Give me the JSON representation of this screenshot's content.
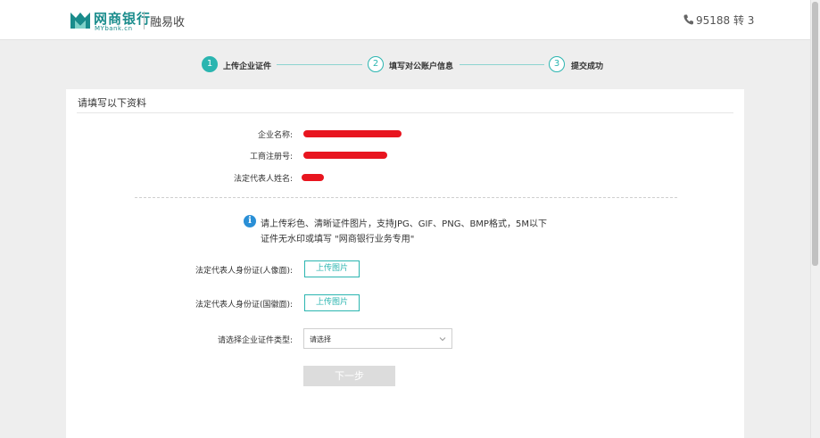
{
  "header": {
    "logo_cn": "网商银行",
    "logo_en": "MYbank.cn",
    "product": "融易收",
    "phone": "95188 转 3"
  },
  "steps": [
    {
      "number": "1",
      "label": "上传企业证件",
      "active": true
    },
    {
      "number": "2",
      "label": "填写对公账户信息",
      "active": false
    },
    {
      "number": "3",
      "label": "提交成功",
      "active": false
    }
  ],
  "form": {
    "title": "请填写以下资料",
    "info": [
      {
        "label": "企业名称:"
      },
      {
        "label": "工商注册号:"
      },
      {
        "label": "法定代表人姓名:"
      }
    ],
    "tip_line1": "请上传彩色、清晰证件图片，支持JPG、GIF、PNG、BMP格式，5M以下",
    "tip_line2": "证件无水印或填写 \"网商银行业务专用\"",
    "uploads": [
      {
        "label": "法定代表人身份证(人像面):",
        "button": "上传图片"
      },
      {
        "label": "法定代表人身份证(国徽面):",
        "button": "上传图片"
      }
    ],
    "select_label": "请选择企业证件类型:",
    "select_value": "请选择",
    "next_button": "下一步"
  },
  "colors": {
    "accent": "#2bb5b0",
    "redact": "#e8151f",
    "info_icon": "#2a8fd6"
  }
}
